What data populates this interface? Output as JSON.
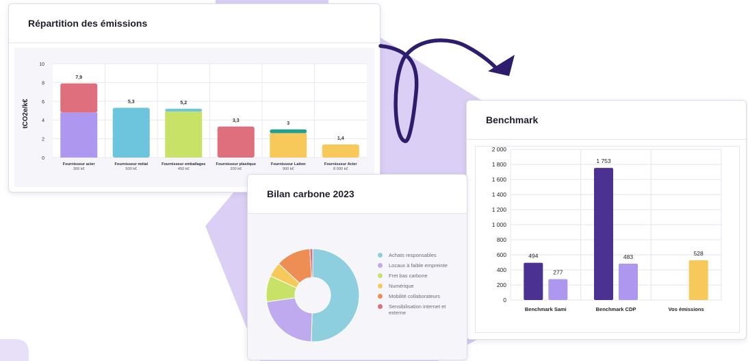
{
  "colors": {
    "purple_dark": "#4b3191",
    "purple_light": "#ae98ef",
    "blue": "#6cc5dc",
    "green": "#c7e267",
    "red": "#df6f7d",
    "yellow": "#f7c95a",
    "orange": "#ee8e54",
    "teal": "#24a090",
    "lavender_bg": "#dccff5",
    "arrow": "#2e1d6d"
  },
  "card1": {
    "title": "Répartition des émissions",
    "chart_data": {
      "type": "bar",
      "stacked": true,
      "ylabel": "tCO2e/k€",
      "ylim": [
        0,
        10
      ],
      "yticks": [
        "0",
        "2",
        "4",
        "6",
        "8",
        "10"
      ],
      "categories": [
        {
          "name": "Fournisseur acier",
          "sub": "300 k€",
          "total": "7,9"
        },
        {
          "name": "Fournisseur métal",
          "sub": "500 k€",
          "total": "5,3"
        },
        {
          "name": "Fournisseur emballages",
          "sub": "450 k€",
          "total": "5,2"
        },
        {
          "name": "Fournisseur plastique",
          "sub": "200 k€",
          "total": "3,3"
        },
        {
          "name": "Fournisseur Laiton",
          "sub": "900 k€",
          "total": "3"
        },
        {
          "name": "Fournisseur Acier",
          "sub": "8 000 k€",
          "total": "1,4"
        }
      ],
      "segments": [
        [
          {
            "value": 4.8,
            "color": "#ae98ef"
          },
          {
            "value": 3.1,
            "color": "#df6f7d"
          }
        ],
        [
          {
            "value": 5.3,
            "color": "#6cc5dc"
          }
        ],
        [
          {
            "value": 4.9,
            "color": "#c7e267"
          },
          {
            "value": 0.3,
            "color": "#6cc5dc"
          }
        ],
        [
          {
            "value": 3.3,
            "color": "#df6f7d"
          }
        ],
        [
          {
            "value": 2.6,
            "color": "#f7c95a"
          },
          {
            "value": 0.4,
            "color": "#24a090"
          }
        ],
        [
          {
            "value": 1.4,
            "color": "#f7c95a"
          }
        ]
      ],
      "grid": true
    }
  },
  "card2": {
    "title": "Benchmark",
    "chart_data": {
      "type": "bar",
      "ylim": [
        0,
        2000
      ],
      "yticks": [
        "0",
        "200",
        "400",
        "600",
        "800",
        "1 000",
        "1 200",
        "1 400",
        "1 600",
        "1 800",
        "2 000"
      ],
      "groups": [
        {
          "name": "Benchmark Sami",
          "bars": [
            {
              "value": 494,
              "label": "494",
              "color": "#4b3191"
            },
            {
              "value": 277,
              "label": "277",
              "color": "#ae98ef"
            }
          ]
        },
        {
          "name": "Benchmark CDP",
          "bars": [
            {
              "value": 1753,
              "label": "1 753",
              "color": "#4b3191"
            },
            {
              "value": 483,
              "label": "483",
              "color": "#ae98ef"
            }
          ]
        },
        {
          "name": "Vos émissions",
          "bars": [
            {
              "value": 528,
              "label": "528",
              "color": "#f7c95a"
            }
          ]
        }
      ],
      "grid": true
    }
  },
  "card3": {
    "title": "Bilan carbone 2023",
    "chart_data": {
      "type": "pie",
      "donut": true,
      "slices": [
        {
          "label": "Achats responsables",
          "value": 50,
          "color": "#8ecfdf"
        },
        {
          "label": "Locaux à faible empreinte",
          "value": 22,
          "color": "#bfaaf0"
        },
        {
          "label": "Fret bas carbone",
          "value": 9,
          "color": "#c7e267"
        },
        {
          "label": "Numérique",
          "value": 5,
          "color": "#f7c95a"
        },
        {
          "label": "Mobilité collaborateurs",
          "value": 12,
          "color": "#ee8e54"
        },
        {
          "label": "Sensibilisation internet et externe",
          "value": 1,
          "color": "#df6f7d"
        }
      ]
    }
  },
  "legend_order": [
    0,
    1,
    2,
    3,
    4,
    5
  ]
}
